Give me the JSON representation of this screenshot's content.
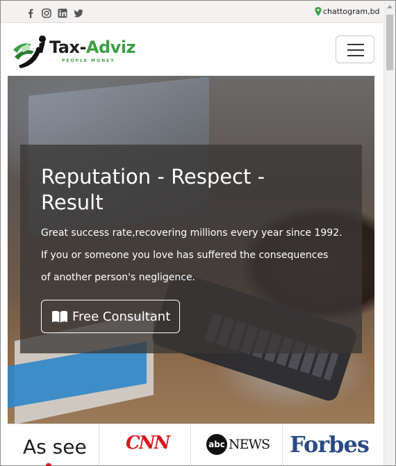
{
  "topbar": {
    "social": [
      "facebook-icon",
      "instagram-icon",
      "linkedin-icon",
      "twitter-icon"
    ],
    "location": "chattogram,bd",
    "location_icon": "map-pin-icon"
  },
  "header": {
    "logo_main": "Tax-",
    "logo_accent": "Adviz",
    "logo_tagline": "PEOPLE MONEY",
    "menu_icon": "hamburger-icon"
  },
  "hero": {
    "title": "Reputation - Respect - Result",
    "line1": "Great success rate,recovering millions every year since 1992.",
    "line2": "If you or someone you love has suffered the consequences",
    "line3": "of another person's negligence.",
    "cta_label": "Free Consultant",
    "cta_icon": "book-icon"
  },
  "media": {
    "heading": "As see",
    "logos": [
      "CNN",
      "abc",
      "NEWS",
      "Forbes"
    ]
  },
  "colors": {
    "brand_green": "#3f9e47",
    "cnn_red": "#d7181f",
    "forbes_blue": "#2b4a86",
    "overlay": "#3a3736"
  }
}
